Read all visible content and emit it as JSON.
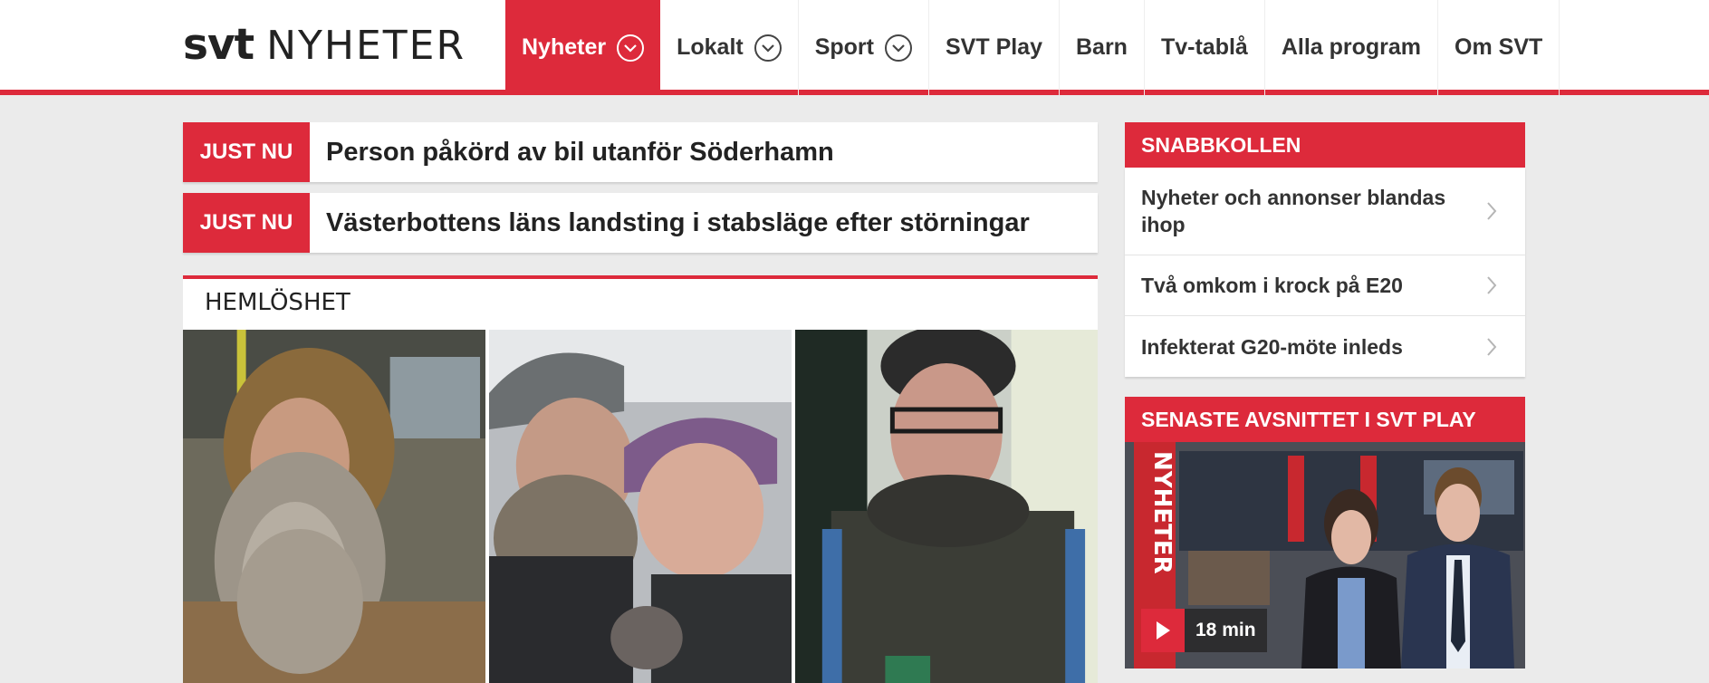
{
  "logo": {
    "brand": "svt",
    "section": "NYHETER"
  },
  "nav": {
    "items": [
      {
        "label": "Nyheter",
        "dropdown": true,
        "active": true
      },
      {
        "label": "Lokalt",
        "dropdown": true
      },
      {
        "label": "Sport",
        "dropdown": true
      },
      {
        "label": "SVT Play"
      },
      {
        "label": "Barn"
      },
      {
        "label": "Tv-tablå"
      },
      {
        "label": "Alla program"
      },
      {
        "label": "Om SVT"
      }
    ]
  },
  "breaking": [
    {
      "tag": "JUST NU",
      "headline": "Person påkörd av bil utanför Söderhamn"
    },
    {
      "tag": "JUST NU",
      "headline": "Västerbottens läns landsting i stabsläge efter störningar"
    }
  ],
  "topic": {
    "title": "HEMLÖSHET"
  },
  "snabbkollen": {
    "title": "SNABBKOLLEN",
    "items": [
      {
        "label": "Nyheter och annonser blandas ihop"
      },
      {
        "label": "Två omkom i krock på E20"
      },
      {
        "label": "Infekterat G20-möte inleds"
      }
    ]
  },
  "svtplay": {
    "title": "SENASTE AVSNITTET I SVT PLAY",
    "duration": "18 min",
    "studio_text": "NYHETER"
  },
  "colors": {
    "accent": "#dd2a3b",
    "background": "#ebebeb"
  }
}
